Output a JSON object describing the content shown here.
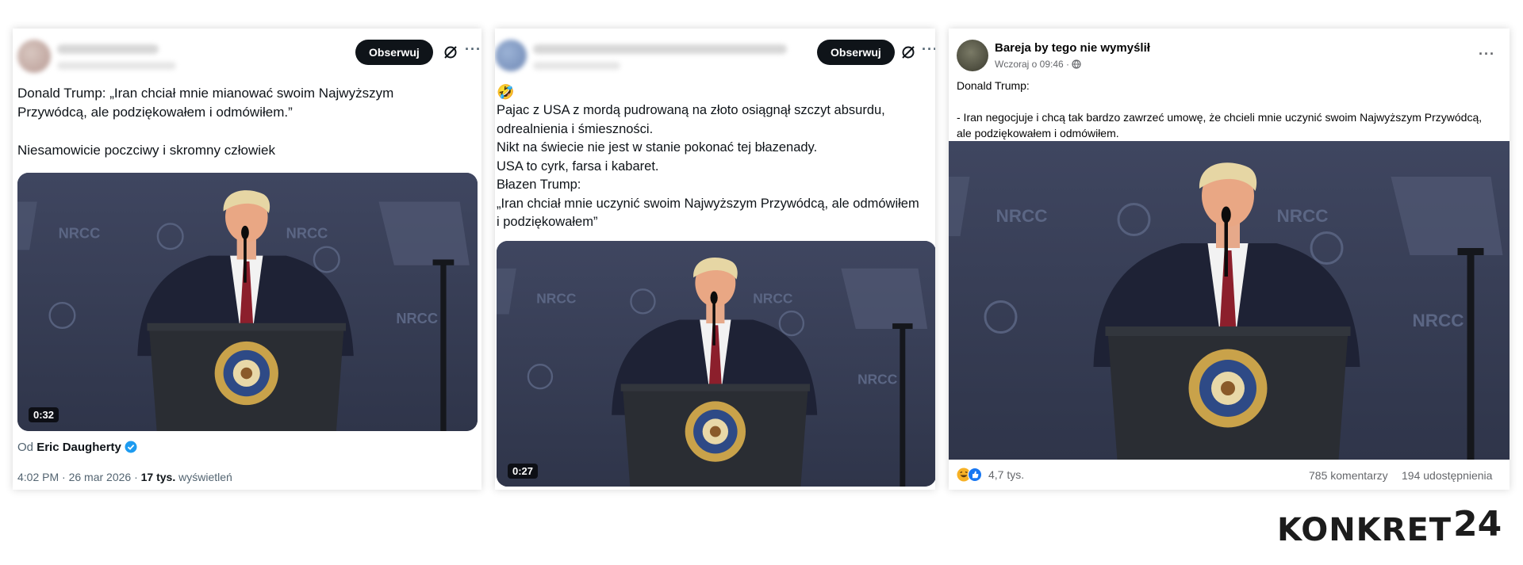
{
  "post1": {
    "follow_label": "Obserwuj",
    "more_label": "···",
    "text": "Donald Trump: „Iran chciał mnie mianować swoim Najwyższym Przywódcą, ale podziękowałem i odmówiłem.”\n\nNiesamowicie poczciwy i skromny człowiek",
    "video_duration": "0:32",
    "source_prefix": "Od",
    "source_name": "Eric Daugherty",
    "timestamp": "4:02 PM · 26 mar 2026 ·",
    "views_count": "17 tys.",
    "views_label": "wyświetleń",
    "stage_labels": [
      "NRCC",
      "NRCC",
      "NRCC"
    ]
  },
  "post2": {
    "follow_label": "Obserwuj",
    "more_label": "···",
    "emoji": "🤣",
    "text": "Pajac z USA z mordą pudrowaną na złoto osiągnął szczyt absurdu, odrealnienia i śmieszności.\nNikt na świecie nie jest w stanie pokonać tej błazenady.\nUSA to cyrk, farsa i kabaret.\nBłazen Trump:\n„Iran chciał mnie uczynić swoim Najwyższym Przywódcą, ale odmówiłem i podziękowałem”",
    "video_duration": "0:27",
    "stage_labels": [
      "NRCC",
      "NRCC",
      "NRCC"
    ]
  },
  "post3": {
    "page_name": "Bareja by tego nie wymyślił",
    "time": "Wczoraj o 09:46 ·",
    "more_label": "···",
    "text": "Donald Trump:\n\n- Iran negocjuje i chcą tak bardzo zawrzeć umowę, że chcieli mnie uczynić swoim Najwyższym Przywódcą, ale podziękowałem i odmówiłem.",
    "reactions_count": "4,7 tys.",
    "comments": "785 komentarzy",
    "shares": "194 udostępnienia",
    "stage_labels": [
      "NRCC",
      "NRCC",
      "NRCC"
    ]
  },
  "brand": {
    "name": "KONKRET",
    "number": "24"
  },
  "colors": {
    "stage_bg": "#3b4257",
    "suit": "#1e2235",
    "podium": "#2a2d33",
    "seal_gold": "#c9a24a",
    "x_black": "#0f1419",
    "verified_blue": "#1d9bf0"
  }
}
